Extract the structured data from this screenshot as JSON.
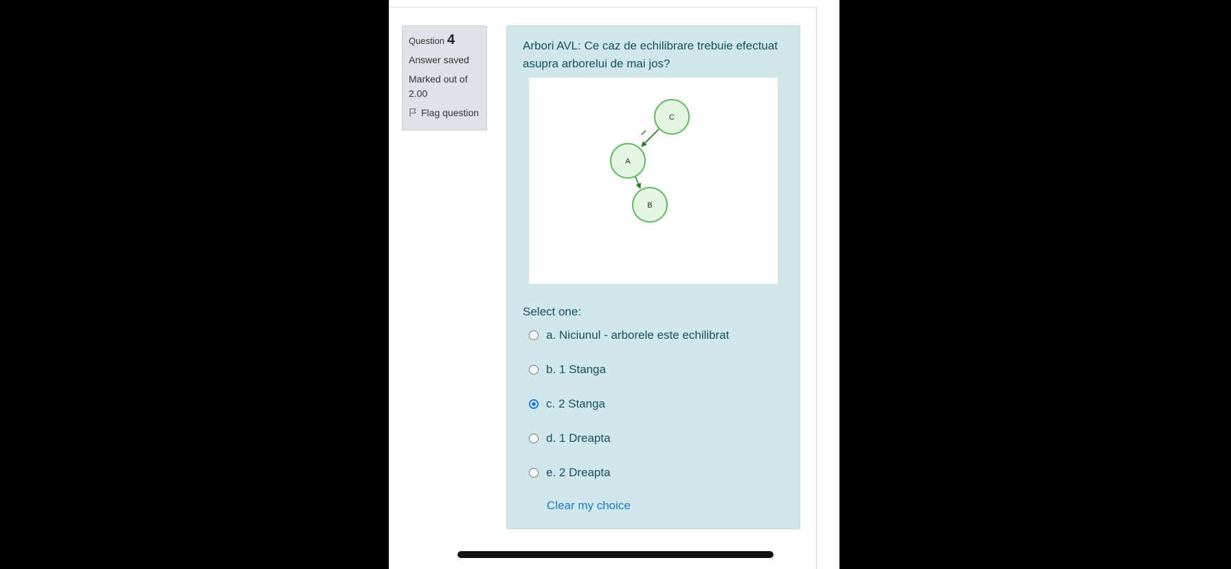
{
  "question": {
    "label": "Question",
    "number": "4",
    "state": "Answer saved",
    "grade": "Marked out of 2.00",
    "flag_label": "Flag question",
    "text": "Arbori AVL: Ce caz de echilibrare trebuie efectuat asupra arborelui de mai jos?"
  },
  "tree": {
    "nodes": [
      "C",
      "A",
      "B"
    ],
    "edges": [
      [
        "C",
        "A"
      ],
      [
        "A",
        "B"
      ]
    ],
    "node_fill": "#e4f5e4",
    "node_stroke": "#5db85d",
    "edge_color": "#1b7d1b"
  },
  "answers": {
    "prompt": "Select one:",
    "options": [
      {
        "label": "a. Niciunul - arborele este echilibrat",
        "checked": false
      },
      {
        "label": "b. 1 Stanga",
        "checked": false
      },
      {
        "label": "c. 2 Stanga",
        "checked": true
      },
      {
        "label": "d. 1 Dreapta",
        "checked": false
      },
      {
        "label": "e. 2 Dreapta",
        "checked": false
      }
    ],
    "clear_label": "Clear my choice"
  },
  "colors": {
    "content_bg": "#cfe6ea",
    "info_bg": "#dee2e6",
    "link": "#1f78c2",
    "radio_selected": "#1a73e8"
  }
}
